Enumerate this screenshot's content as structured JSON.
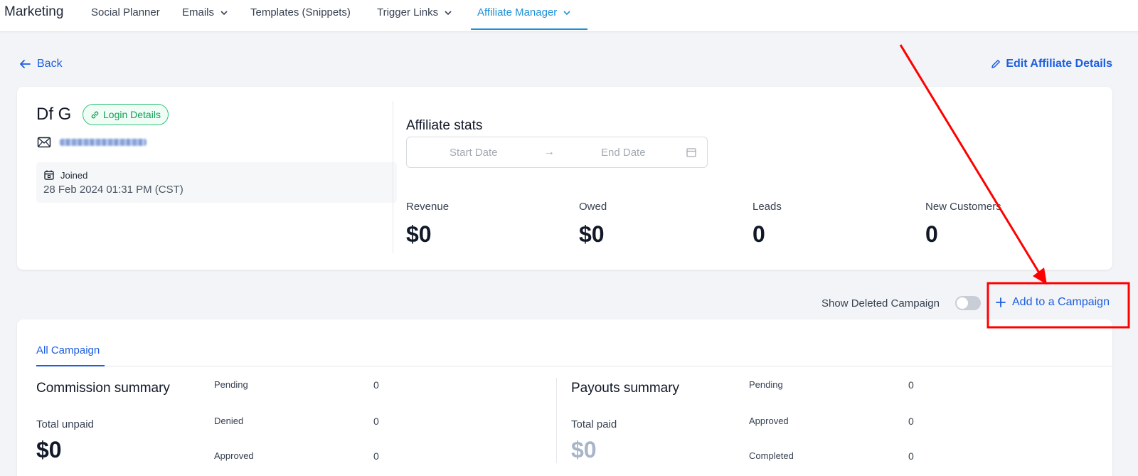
{
  "nav": {
    "brand": "Marketing",
    "items": [
      {
        "label": "Social Planner"
      },
      {
        "label": "Emails"
      },
      {
        "label": "Templates (Snippets)"
      },
      {
        "label": "Trigger Links"
      },
      {
        "label": "Affiliate Manager"
      }
    ]
  },
  "actions": {
    "back_label": "Back",
    "edit_label": "Edit Affiliate Details"
  },
  "affiliate": {
    "name": "Df G",
    "login_badge": "Login Details",
    "joined_label": "Joined",
    "joined_date": "28 Feb 2024 01:31 PM (CST)"
  },
  "stats": {
    "title": "Affiliate stats",
    "start_placeholder": "Start Date",
    "end_placeholder": "End Date",
    "items": [
      {
        "label": "Revenue",
        "value": "$0"
      },
      {
        "label": "Owed",
        "value": "$0"
      },
      {
        "label": "Leads",
        "value": "0"
      },
      {
        "label": "New Customers",
        "value": "0"
      }
    ]
  },
  "campaign_controls": {
    "show_deleted_label": "Show Deleted Campaign",
    "show_deleted_on": false,
    "add_label": "Add to a Campaign"
  },
  "campaigns": {
    "tab": "All Campaign",
    "commission": {
      "title": "Commission summary",
      "subtitle": "Total unpaid",
      "total": "$0",
      "rows": [
        {
          "label": "Pending",
          "value": "0"
        },
        {
          "label": "Denied",
          "value": "0"
        },
        {
          "label": "Approved",
          "value": "0"
        }
      ]
    },
    "payouts": {
      "title": "Payouts summary",
      "subtitle": "Total paid",
      "total": "$0",
      "rows": [
        {
          "label": "Pending",
          "value": "0"
        },
        {
          "label": "Approved",
          "value": "0"
        },
        {
          "label": "Completed",
          "value": "0"
        }
      ]
    }
  },
  "colors": {
    "accent": "#1d5ee0",
    "nav_active": "#1e90d6",
    "success": "#16a05a",
    "annotation": "#ff0000"
  }
}
